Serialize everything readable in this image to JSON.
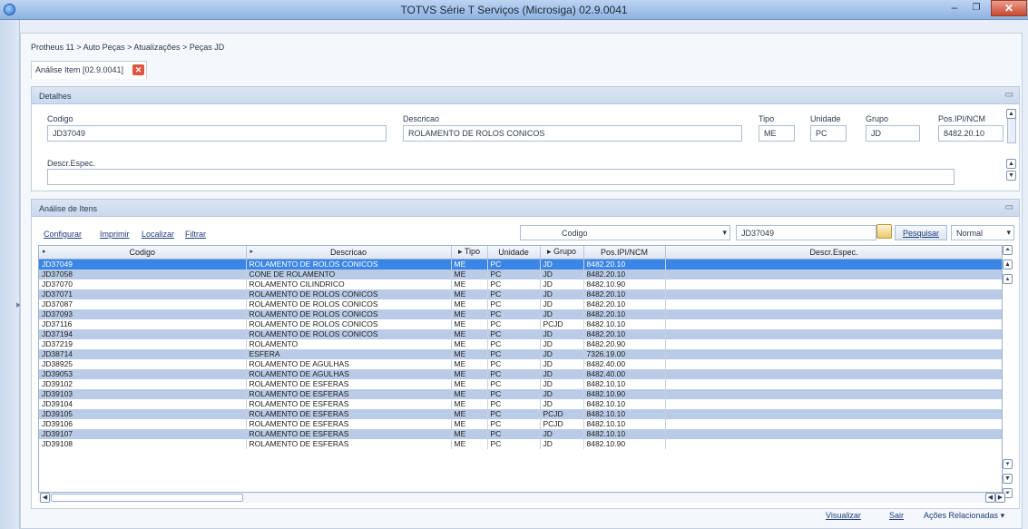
{
  "window": {
    "title": "TOTVS Série T Serviços (Microsiga) 02.9.0041",
    "min_glyph": "–",
    "max_glyph": "❐",
    "close_glyph": "✕"
  },
  "breadcrumb": "Protheus 11 > Auto Peças > Atualizações > Peças JD",
  "tab": {
    "label": "Análise Item [02.9.0041]",
    "close_glyph": "✕"
  },
  "detalhes": {
    "header": "Detalhes",
    "fields": {
      "codigo": {
        "label": "Codigo",
        "value": "JD37049"
      },
      "descricao": {
        "label": "Descricao",
        "value": "ROLAMENTO DE ROLOS CONICOS"
      },
      "tipo": {
        "label": "Tipo",
        "value": "ME"
      },
      "unidade": {
        "label": "Unidade",
        "value": "PC"
      },
      "grupo": {
        "label": "Grupo",
        "value": "JD"
      },
      "pos_ipi": {
        "label": "Pos.IPI/NCM",
        "value": "8482.20.10"
      },
      "descr_espec": {
        "label": "Descr.Espec.",
        "value": ""
      }
    }
  },
  "analise": {
    "header": "Análise de Itens",
    "toolbar": {
      "configurar": "Configurar",
      "imprimir": "Imprimir",
      "localizar": "Localizar",
      "filtrar": "Filtrar"
    },
    "search": {
      "field": "Codigo",
      "value": "JD37049",
      "button": "Pesquisar",
      "mode": "Normal"
    },
    "columns": [
      "Codigo",
      "Descricao",
      "Tipo",
      "Unidade",
      "Grupo",
      "Pos.IPI/NCM",
      "Descr.Espec."
    ],
    "rows": [
      [
        "JD37049",
        "ROLAMENTO DE ROLOS CONICOS",
        "ME",
        "PC",
        "JD",
        "8482.20.10",
        ""
      ],
      [
        "JD37058",
        "CONE DE ROLAMENTO",
        "ME",
        "PC",
        "JD",
        "8482.20.10",
        ""
      ],
      [
        "JD37070",
        "ROLAMENTO CILINDRICO",
        "ME",
        "PC",
        "JD",
        "8482.10.90",
        ""
      ],
      [
        "JD37071",
        "ROLAMENTO DE ROLOS CONICOS",
        "ME",
        "PC",
        "JD",
        "8482.20.10",
        ""
      ],
      [
        "JD37087",
        "ROLAMENTO DE ROLOS CONICOS",
        "ME",
        "PC",
        "JD",
        "8482.20.10",
        ""
      ],
      [
        "JD37093",
        "ROLAMENTO DE ROLOS CONICOS",
        "ME",
        "PC",
        "JD",
        "8482.20.10",
        ""
      ],
      [
        "JD37116",
        "ROLAMENTO DE ROLOS CONICOS",
        "ME",
        "PC",
        "PCJD",
        "8482.10.10",
        ""
      ],
      [
        "JD37194",
        "ROLAMENTO DE ROLOS CONICOS",
        "ME",
        "PC",
        "JD",
        "8482.20.10",
        ""
      ],
      [
        "JD37219",
        "ROLAMENTO",
        "ME",
        "PC",
        "JD",
        "8482.20.90",
        ""
      ],
      [
        "JD38714",
        "ESFERA",
        "ME",
        "PC",
        "JD",
        "7326.19.00",
        ""
      ],
      [
        "JD38925",
        "ROLAMENTO DE AGULHAS",
        "ME",
        "PC",
        "JD",
        "8482.40.00",
        ""
      ],
      [
        "JD39053",
        "ROLAMENTO DE AGULHAS",
        "ME",
        "PC",
        "JD",
        "8482.40.00",
        ""
      ],
      [
        "JD39102",
        "ROLAMENTO DE ESFERAS",
        "ME",
        "PC",
        "JD",
        "8482.10.10",
        ""
      ],
      [
        "JD39103",
        "ROLAMENTO DE ESFERAS",
        "ME",
        "PC",
        "JD",
        "8482.10.90",
        ""
      ],
      [
        "JD39104",
        "ROLAMENTO DE ESFERAS",
        "ME",
        "PC",
        "JD",
        "8482.10.10",
        ""
      ],
      [
        "JD39105",
        "ROLAMENTO DE ESFERAS",
        "ME",
        "PC",
        "PCJD",
        "8482.10.10",
        ""
      ],
      [
        "JD39106",
        "ROLAMENTO DE ESFERAS",
        "ME",
        "PC",
        "PCJD",
        "8482.10.10",
        ""
      ],
      [
        "JD39107",
        "ROLAMENTO DE ESFERAS",
        "ME",
        "PC",
        "JD",
        "8482.10.10",
        ""
      ],
      [
        "JD39108",
        "ROLAMENTO DE ESFERAS",
        "ME",
        "PC",
        "JD",
        "8482.10.90",
        ""
      ]
    ]
  },
  "actions": {
    "visualizar": "Visualizar",
    "sair": "Sair",
    "acoes": "Ações Relacionadas"
  },
  "colors": {
    "accent": "#3a86e6",
    "alt_row": "#b9cbe6",
    "title_bar": "#8fb2e0"
  },
  "icons": [
    "app-icon",
    "close-icon",
    "collapse-icon",
    "dropdown-icon",
    "search-icon",
    "scroll-up-icon",
    "scroll-down-icon",
    "scroll-left-icon",
    "scroll-right-icon"
  ]
}
